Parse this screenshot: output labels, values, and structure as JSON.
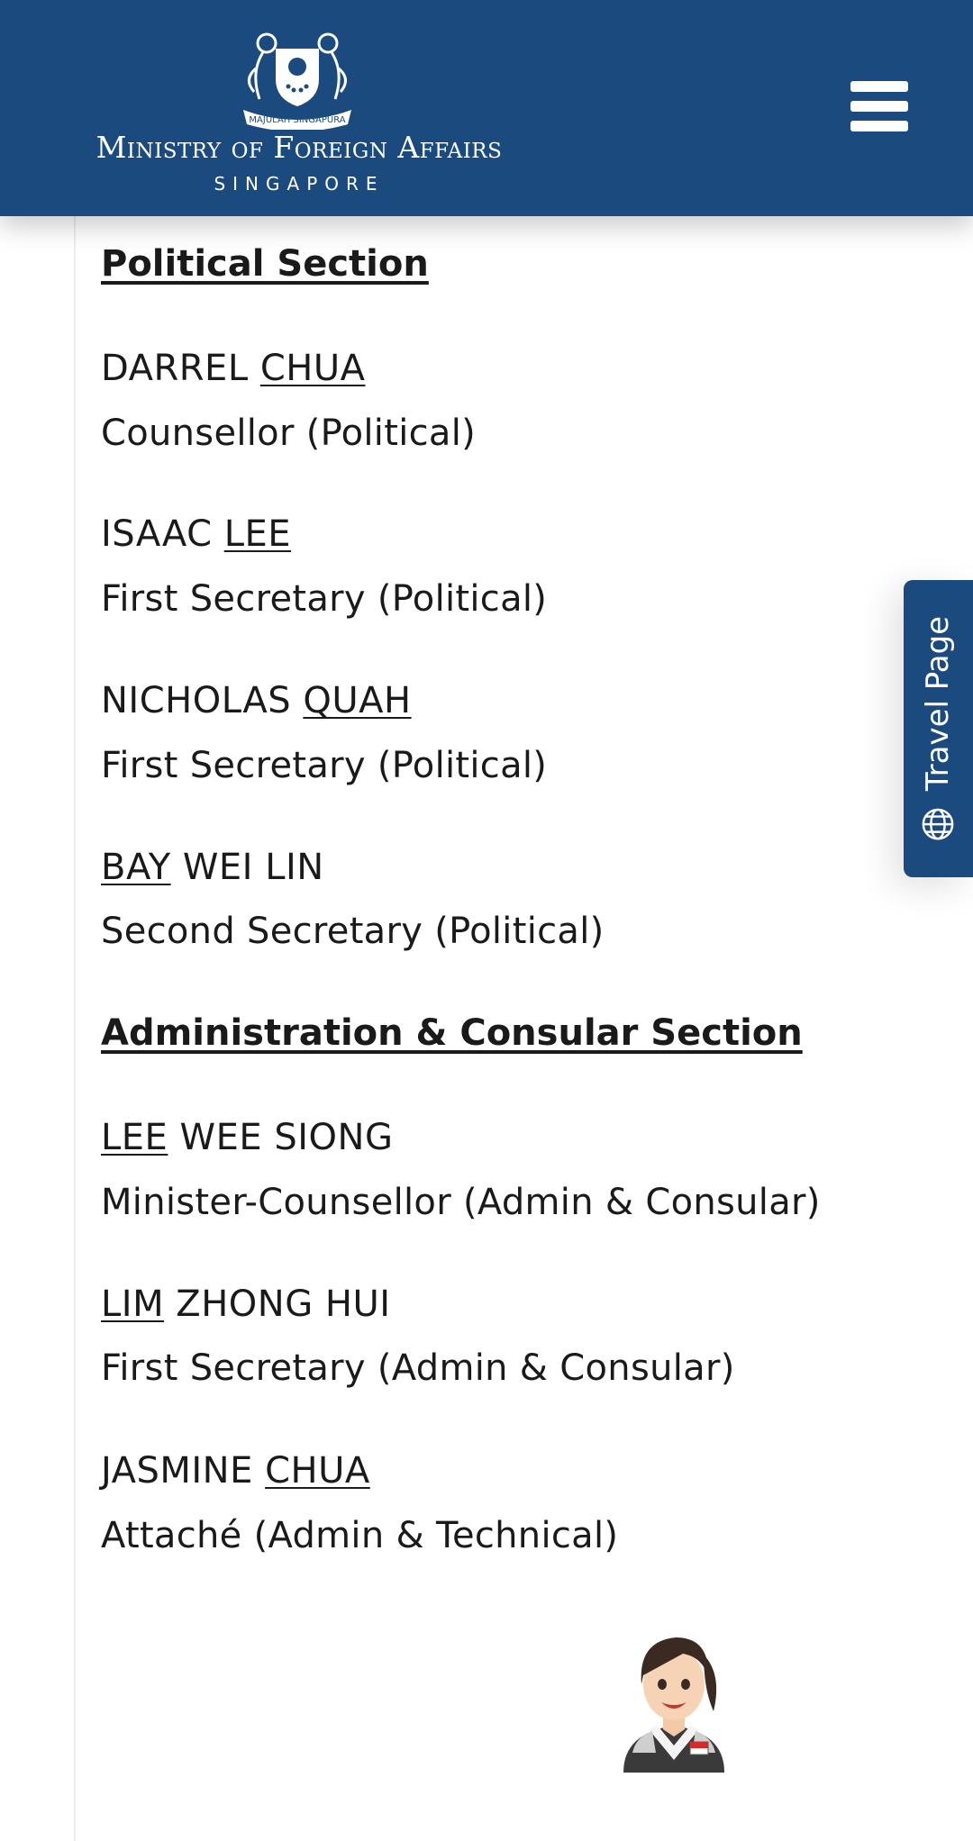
{
  "header": {
    "logo_motto": "MAJULAH SINGAPURA",
    "brand_title": "Ministry of Foreign Affairs",
    "brand_subtitle": "SINGAPORE",
    "menu_icon": "hamburger-menu-icon",
    "background_color": "#1b4a7e"
  },
  "sections": [
    {
      "heading": "Political Section",
      "staff": [
        {
          "given": "DARREL ",
          "surname": "CHUA",
          "role": "Counsellor (Political)"
        },
        {
          "given": "ISAAC ",
          "surname": "LEE",
          "role": "First Secretary (Political)"
        },
        {
          "given": "NICHOLAS ",
          "surname": "QUAH",
          "role": "First Secretary (Political)"
        },
        {
          "surname": "BAY",
          "given": " WEI LIN",
          "role": "Second Secretary (Political)"
        }
      ]
    },
    {
      "heading": "Administration & Consular Section",
      "staff": [
        {
          "surname": "LEE",
          "given": " WEE SIONG",
          "role": "Minister-Counsellor (Admin & Consular)"
        },
        {
          "surname": "LIM",
          "given": " ZHONG HUI",
          "role": "First Secretary (Admin & Consular)"
        },
        {
          "given": "JASMINE ",
          "surname": "CHUA",
          "role": "Attaché (Admin & Technical)"
        }
      ]
    }
  ],
  "travel_tab": {
    "label": "Travel Page",
    "icon": "globe-icon"
  },
  "assistant": {
    "icon": "virtual-assistant-avatar"
  }
}
